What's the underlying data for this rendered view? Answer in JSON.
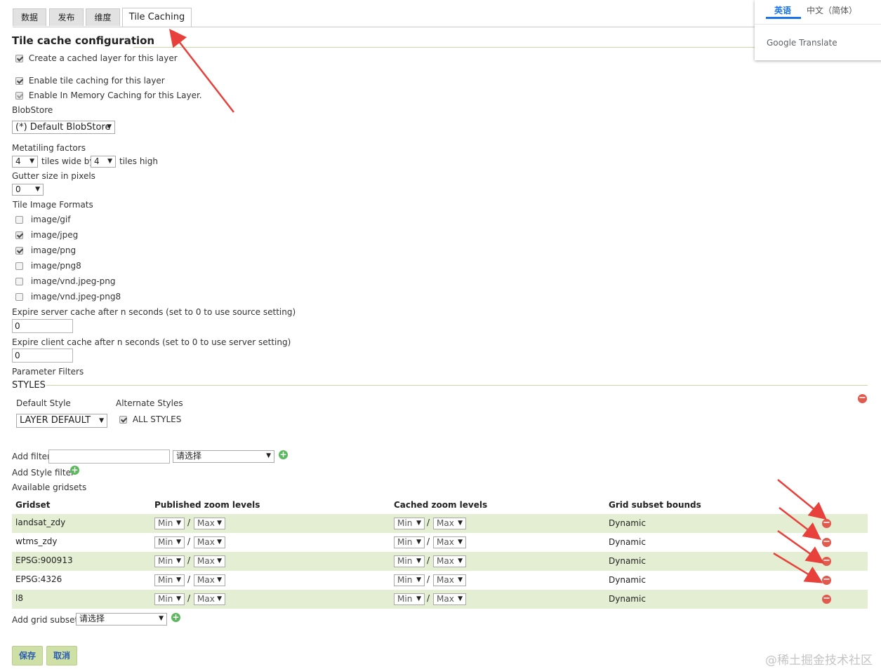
{
  "tabs": [
    {
      "label": "数据",
      "active": false
    },
    {
      "label": "发布",
      "active": false
    },
    {
      "label": "维度",
      "active": false
    },
    {
      "label": "Tile Caching",
      "active": true
    }
  ],
  "tile_cache": {
    "title": "Tile cache configuration",
    "create_cached_layer": {
      "label": "Create a cached layer for this layer",
      "checked": true
    },
    "enable_tile_caching": {
      "label": "Enable tile caching for this layer",
      "checked": true
    },
    "enable_in_memory": {
      "label": "Enable In Memory Caching for this Layer.",
      "checked": true
    },
    "blobstore_label": "BlobStore",
    "blobstore_value": "(*) Default BlobStore",
    "metatiling_label": "Metatiling factors",
    "metatile_wide": "4",
    "tiles_wide_by": "tiles wide by",
    "metatile_high": "4",
    "tiles_high": "tiles high",
    "gutter_label": "Gutter size in pixels",
    "gutter_value": "0",
    "formats_label": "Tile Image Formats",
    "formats": [
      {
        "label": "image/gif",
        "checked": false
      },
      {
        "label": "image/jpeg",
        "checked": true
      },
      {
        "label": "image/png",
        "checked": true
      },
      {
        "label": "image/png8",
        "checked": false
      },
      {
        "label": "image/vnd.jpeg-png",
        "checked": false
      },
      {
        "label": "image/vnd.jpeg-png8",
        "checked": false
      }
    ],
    "expire_server_label": "Expire server cache after n seconds (set to 0 to use source setting)",
    "expire_server_value": "0",
    "expire_client_label": "Expire client cache after n seconds (set to 0 to use server setting)",
    "expire_client_value": "0",
    "parameter_filters_label": "Parameter Filters"
  },
  "styles": {
    "title": "STYLES",
    "default_style_label": "Default Style",
    "alternate_styles_label": "Alternate Styles",
    "default_style_value": "LAYER DEFAULT",
    "all_styles": {
      "label": "ALL STYLES",
      "checked": true
    }
  },
  "filters": {
    "add_filter_label": "Add filter",
    "add_filter_value": "",
    "add_filter_select": "请选择",
    "add_style_filter_label": "Add Style filter",
    "available_gridsets_label": "Available gridsets"
  },
  "gridsets": {
    "headers": {
      "gridset": "Gridset",
      "published": "Published zoom levels",
      "cached": "Cached zoom levels",
      "bounds": "Grid subset bounds"
    },
    "rows": [
      {
        "name": "landsat_zdy",
        "pub_min": "Min",
        "pub_max": "Max",
        "cache_min": "Min",
        "cache_max": "Max",
        "bounds": "Dynamic"
      },
      {
        "name": "wtms_zdy",
        "pub_min": "Min",
        "pub_max": "Max",
        "cache_min": "Min",
        "cache_max": "Max",
        "bounds": "Dynamic"
      },
      {
        "name": "EPSG:900913",
        "pub_min": "Min",
        "pub_max": "Max",
        "cache_min": "Min",
        "cache_max": "Max",
        "bounds": "Dynamic"
      },
      {
        "name": "EPSG:4326",
        "pub_min": "Min",
        "pub_max": "Max",
        "cache_min": "Min",
        "cache_max": "Max",
        "bounds": "Dynamic"
      },
      {
        "name": "l8",
        "pub_min": "Min",
        "pub_max": "Max",
        "cache_min": "Min",
        "cache_max": "Max",
        "bounds": "Dynamic"
      }
    ],
    "separator": "/",
    "add_grid_subset_label": "Add grid subset:",
    "add_grid_subset_value": "请选择"
  },
  "buttons": {
    "save": "保存",
    "cancel": "取消"
  },
  "translate_popup": {
    "tab_english": "英语",
    "tab_chinese": "中文（简体）",
    "brand": "Google Translate"
  },
  "watermark": "@稀土掘金技术社区",
  "colors": {
    "accent_green": "#c8d9a8",
    "row_alt": "#e3eed2",
    "remove_red": "#e05a4e",
    "add_green": "#5cb85c",
    "arrow_red": "#e8403a"
  }
}
